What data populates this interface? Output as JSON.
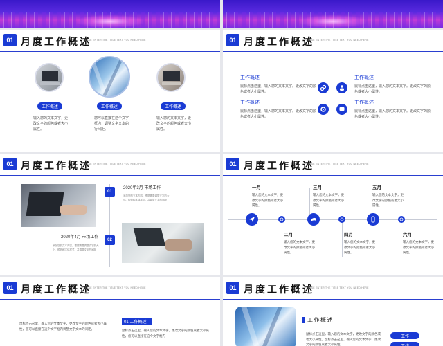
{
  "slides": {
    "s1": {
      "badge": "01",
      "title": "月度工作概述",
      "subtitle": "PLEASE ENTER THE TITLE TEXT YOU NEED HERE",
      "items": [
        {
          "label": "工作概述",
          "text": "输入您的文本文字，更改文字的颜色或者大小属性。"
        },
        {
          "label": "工作概述",
          "text": "您可以直接在这个文字框内，调整文字文本的行间距。"
        },
        {
          "label": "工作概述",
          "text": "输入您的文本文字，更改文字的颜色或者大小属性。"
        }
      ]
    },
    "s2": {
      "badge": "01",
      "title": "月度工作概述",
      "subtitle": "PLEASE ENTER THE TITLE TEXT YOU NEED HERE",
      "items": [
        {
          "heading": "工作概述",
          "text": "鼠标点击这里，输入您的文本文字。更改文字的颜色或者大小属性。"
        },
        {
          "heading": "工作概述",
          "text": "鼠标点击这里，输入您的文本文字。更改文字的颜色或者大小属性。"
        },
        {
          "heading": "工作概述",
          "text": "鼠标点击这里，输入您的文本文字。更改文字的颜色或者大小属性。"
        },
        {
          "heading": "工作概述",
          "text": "鼠标点击这里，输入您的文本文字。更改文字的颜色或者大小属性。"
        }
      ]
    },
    "s3": {
      "badge": "01",
      "title": "月度工作概述",
      "subtitle": "PLEASE ENTER THE TITLE TEXT YOU NEED HERE",
      "step1": {
        "num": "01",
        "heading": "2020年3月  市场工作",
        "text": "添加您的文本内容，根据需要调整文字的大小、颜色和字体样式，并调整文字的间距"
      },
      "step2": {
        "num": "02",
        "heading": "2020年4月  市场工作",
        "text": "添加您的文本内容，根据需要调整文字的大小、颜色和字体样式，并调整文字的间距"
      }
    },
    "s4": {
      "badge": "01",
      "title": "月度工作概述",
      "subtitle": "PLEASE ENTER THE TITLE TEXT YOU NEED HERE",
      "top": [
        {
          "month": "一月",
          "text": "输入您的文本文字，更改文字的颜色或者大小属性。"
        },
        {
          "month": "三月",
          "text": "输入您的文本文字，更改文字的颜色或者大小属性。"
        },
        {
          "month": "五月",
          "text": "输入您的文本文字，更改文字的颜色或者大小属性。"
        }
      ],
      "bottom": [
        {
          "month": "二月",
          "text": "输入您的文本文字，更改文字的颜色或者大小属性。"
        },
        {
          "month": "四月",
          "text": "输入您的文本文字，更改文字的颜色或者大小属性。"
        },
        {
          "month": "六月",
          "text": "输入您的文本文字，更改文字的颜色或者大小属性。"
        }
      ]
    },
    "s5": {
      "badge": "01",
      "title": "月度工作概述",
      "subtitle": "PLEASE ENTER THE TITLE TEXT YOU NEED HERE",
      "text_a": "鼠标点击这里，输入您的文本文字，更改文字的颜色或者大小属性，您可以直接在这个文字框内调整文字文本的间距。",
      "tag": "01-工作概述",
      "text_b": "鼠标点击这里，输入您的文本文字，更改文字的颜色或者大小属性，您可以直接在这个文字框内"
    },
    "s6": {
      "badge": "01",
      "title": "月度工作概述",
      "subtitle": "PLEASE ENTER THE TITLE TEXT YOU NEED HERE",
      "heading": "工作概述",
      "text": "鼠标点击这里，输入您的文本文字，更改文字的颜色或者大小属性。鼠标点击这里，输入您的文本文字，更改文字的颜色或者大小属性。",
      "pill1": "工作",
      "pill2": "工作"
    }
  },
  "colors": {
    "accent": "#1a3bd4",
    "background": "#e6e7ec"
  },
  "icons": [
    "link-icon",
    "people-icon",
    "gear-icon",
    "chat-icon",
    "send-icon",
    "clock-icon",
    "flag-icon",
    "phone-icon"
  ]
}
